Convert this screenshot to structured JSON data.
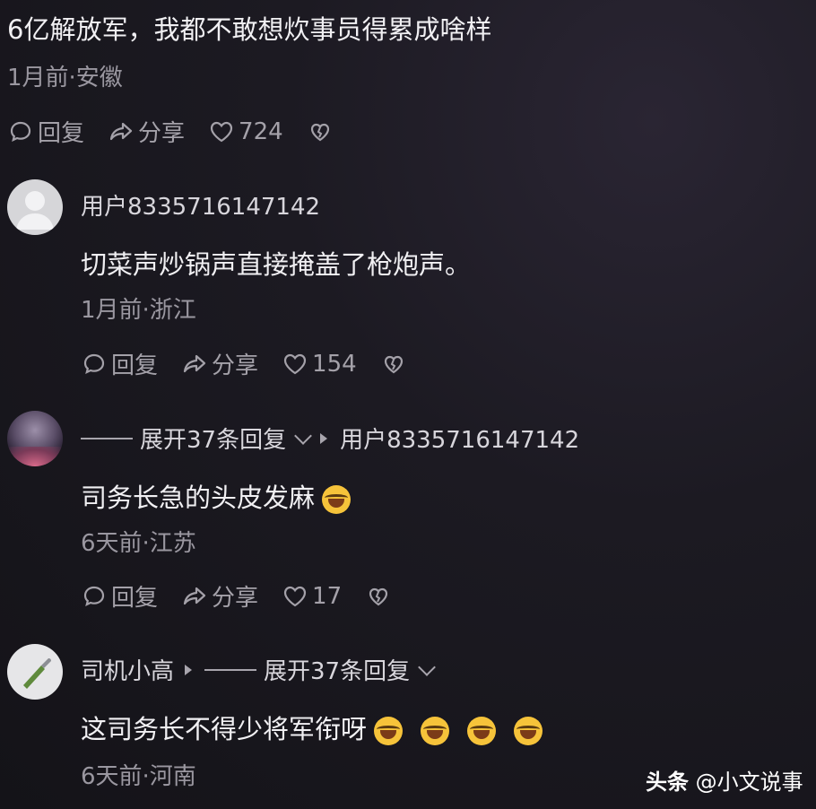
{
  "top_comment": {
    "text": "6亿解放军，我都不敢想炊事员得累成啥样",
    "meta": "1月前·安徽",
    "reply_label": "回复",
    "share_label": "分享",
    "likes": "724"
  },
  "comments": [
    {
      "username": "用户8335716147142",
      "text": "切菜声炒锅声直接掩盖了枪炮声。",
      "meta": "1月前·浙江",
      "reply_label": "回复",
      "share_label": "分享",
      "likes": "154"
    },
    {
      "expand_label": "展开37条回复",
      "reply_to": "用户8335716147142",
      "text": "司务长急的头皮发麻",
      "meta": "6天前·江苏",
      "reply_label": "回复",
      "share_label": "分享",
      "likes": "17"
    },
    {
      "username": "司机小高",
      "expand_label": "展开37条回复",
      "text": "这司务长不得少将军衔呀",
      "meta": "6天前·河南"
    }
  ],
  "watermark": {
    "brand": "头条",
    "account": "@小文说事"
  },
  "colors": {
    "background": "#17161c",
    "text": "#f1f0f3",
    "meta": "#9a97a0",
    "emoji": "#f6c33a"
  }
}
